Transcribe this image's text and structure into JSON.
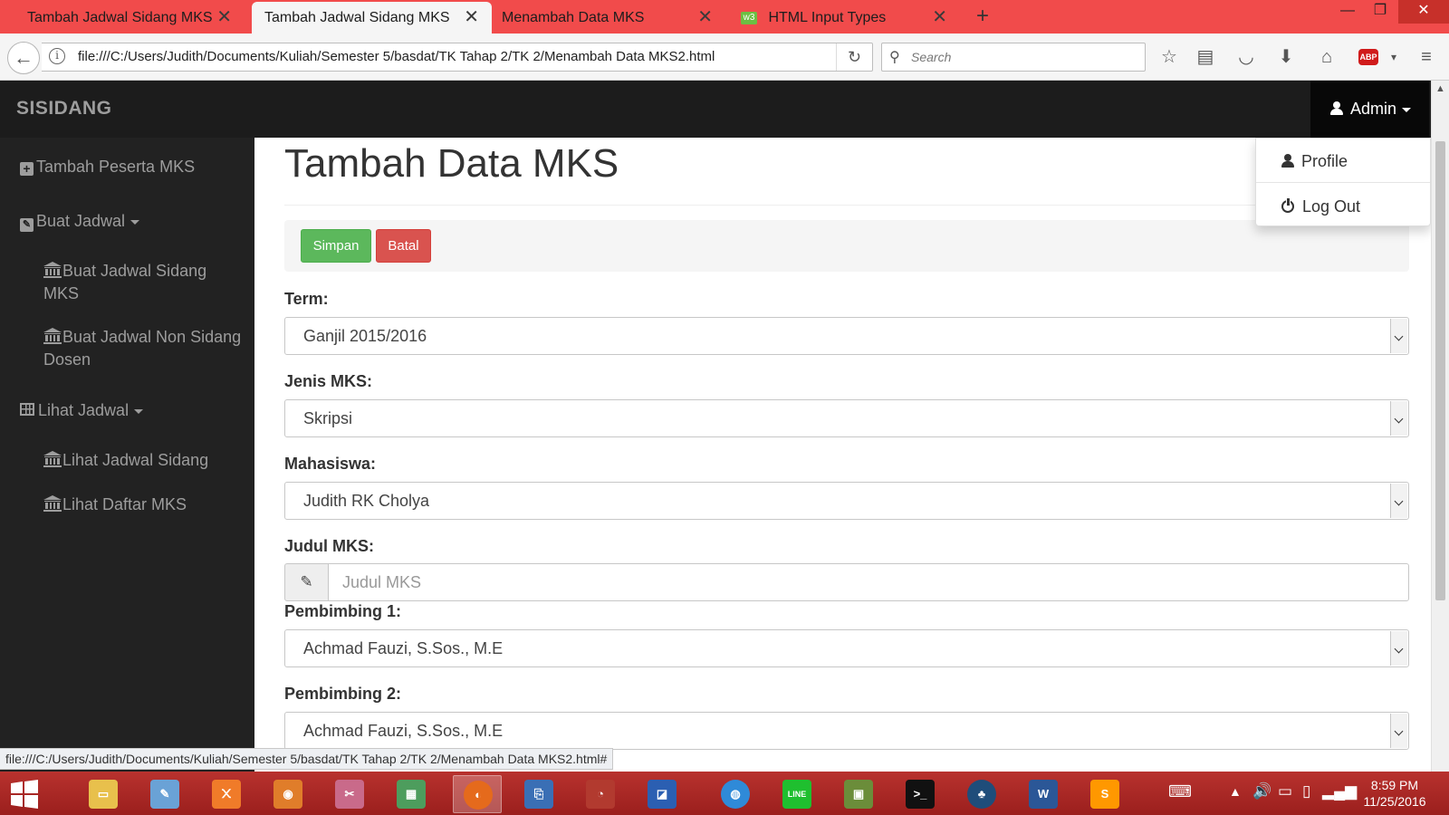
{
  "browser": {
    "tabs": [
      {
        "title": "Tambah Jadwal Sidang MKS",
        "active": false
      },
      {
        "title": "Tambah Jadwal Sidang MKS",
        "active": true
      },
      {
        "title": "Menambah Data MKS",
        "active": false
      },
      {
        "title": "HTML Input Types",
        "active": false,
        "favicon": "w3"
      }
    ],
    "url": "file:///C:/Users/Judith/Documents/Kuliah/Semester 5/basdat/TK Tahap 2/TK 2/Menambah Data MKS2.html",
    "search_placeholder": "Search",
    "abp_label": "ABP",
    "status_url": "file:///C:/Users/Judith/Documents/Kuliah/Semester 5/basdat/TK Tahap 2/TK 2/Menambah Data MKS2.html#"
  },
  "app": {
    "brand": "SISIDANG",
    "user_menu": {
      "label": "Admin",
      "items": [
        {
          "label": "Profile",
          "icon": "user-icon"
        },
        {
          "label": "Log Out",
          "icon": "power-icon"
        }
      ]
    },
    "sidebar": {
      "items": [
        {
          "label": "Tambah Peserta MKS",
          "icon": "plus-square-icon"
        },
        {
          "label": "Buat Jadwal",
          "icon": "edit-icon",
          "has_caret": true
        },
        {
          "label": "Buat Jadwal Sidang MKS",
          "icon": "bank-icon",
          "sub": true
        },
        {
          "label": "Buat Jadwal Non Sidang Dosen",
          "icon": "bank-icon",
          "sub": true
        },
        {
          "label": "Lihat Jadwal",
          "icon": "table-icon",
          "has_caret": true
        },
        {
          "label": "Lihat Jadwal Sidang",
          "icon": "bank-icon",
          "sub": true
        },
        {
          "label": "Lihat Daftar MKS",
          "icon": "bank-icon",
          "sub": true
        }
      ]
    },
    "main": {
      "title": "Tambah Data MKS",
      "buttons": {
        "save": "Simpan",
        "cancel": "Batal"
      },
      "form": {
        "term": {
          "label": "Term:",
          "value": "Ganjil 2015/2016"
        },
        "jenis": {
          "label": "Jenis MKS:",
          "value": "Skripsi"
        },
        "mahasiswa": {
          "label": "Mahasiswa:",
          "value": "Judith RK Cholya"
        },
        "judul": {
          "label": "Judul MKS:",
          "placeholder": "Judul MKS",
          "value": ""
        },
        "pembimbing1": {
          "label": "Pembimbing 1:",
          "value": "Achmad Fauzi, S.Sos., M.E"
        },
        "pembimbing2": {
          "label": "Pembimbing 2:",
          "value": "Achmad Fauzi, S.Sos., M.E"
        }
      }
    }
  },
  "taskbar": {
    "clock_time": "8:59 PM",
    "clock_date": "11/25/2016",
    "apps": [
      "file-explorer",
      "paint",
      "xampp",
      "blender",
      "paint-tool",
      "network-tool",
      "firefox",
      "remote-desktop",
      "photo-tool",
      "folder-tool",
      "browser-tool",
      "line",
      "minecraft",
      "terminal",
      "tree-tool",
      "word",
      "sublime"
    ]
  },
  "colors": {
    "tabbar": "#f14b4b",
    "navbar_dark": "#1c1c1c",
    "sidebar": "#222222",
    "success": "#5cb85c",
    "danger": "#d9534f",
    "taskbar": "#b8322e"
  }
}
